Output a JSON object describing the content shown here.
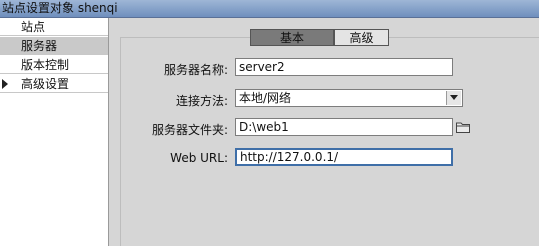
{
  "window": {
    "title": "站点设置对象 shenqi"
  },
  "sidebar": {
    "items": [
      {
        "label": "站点"
      },
      {
        "label": "服务器"
      },
      {
        "label": "版本控制"
      },
      {
        "label": "高级设置"
      }
    ],
    "selected": "服务器"
  },
  "tabs": [
    {
      "label": "基本",
      "active": true
    },
    {
      "label": "高级",
      "active": false
    }
  ],
  "form": {
    "server_name": {
      "label": "服务器名称:",
      "value": "server2"
    },
    "connect_method": {
      "label": "连接方法:",
      "value": "本地/网络"
    },
    "server_folder": {
      "label": "服务器文件夹:",
      "value": "D:\\web1"
    },
    "web_url": {
      "label": "Web URL:",
      "value": "http://127.0.0.1/"
    }
  },
  "icons": {
    "folder": "folder-icon",
    "expand": "triangle-right-icon",
    "dropdown": "chevron-down-icon"
  },
  "colors": {
    "titlebar": "#8aa6cc",
    "active_tab": "#7a7a7a",
    "focus_border": "#3f6fa8",
    "selected_item": "#c9c9c9"
  }
}
